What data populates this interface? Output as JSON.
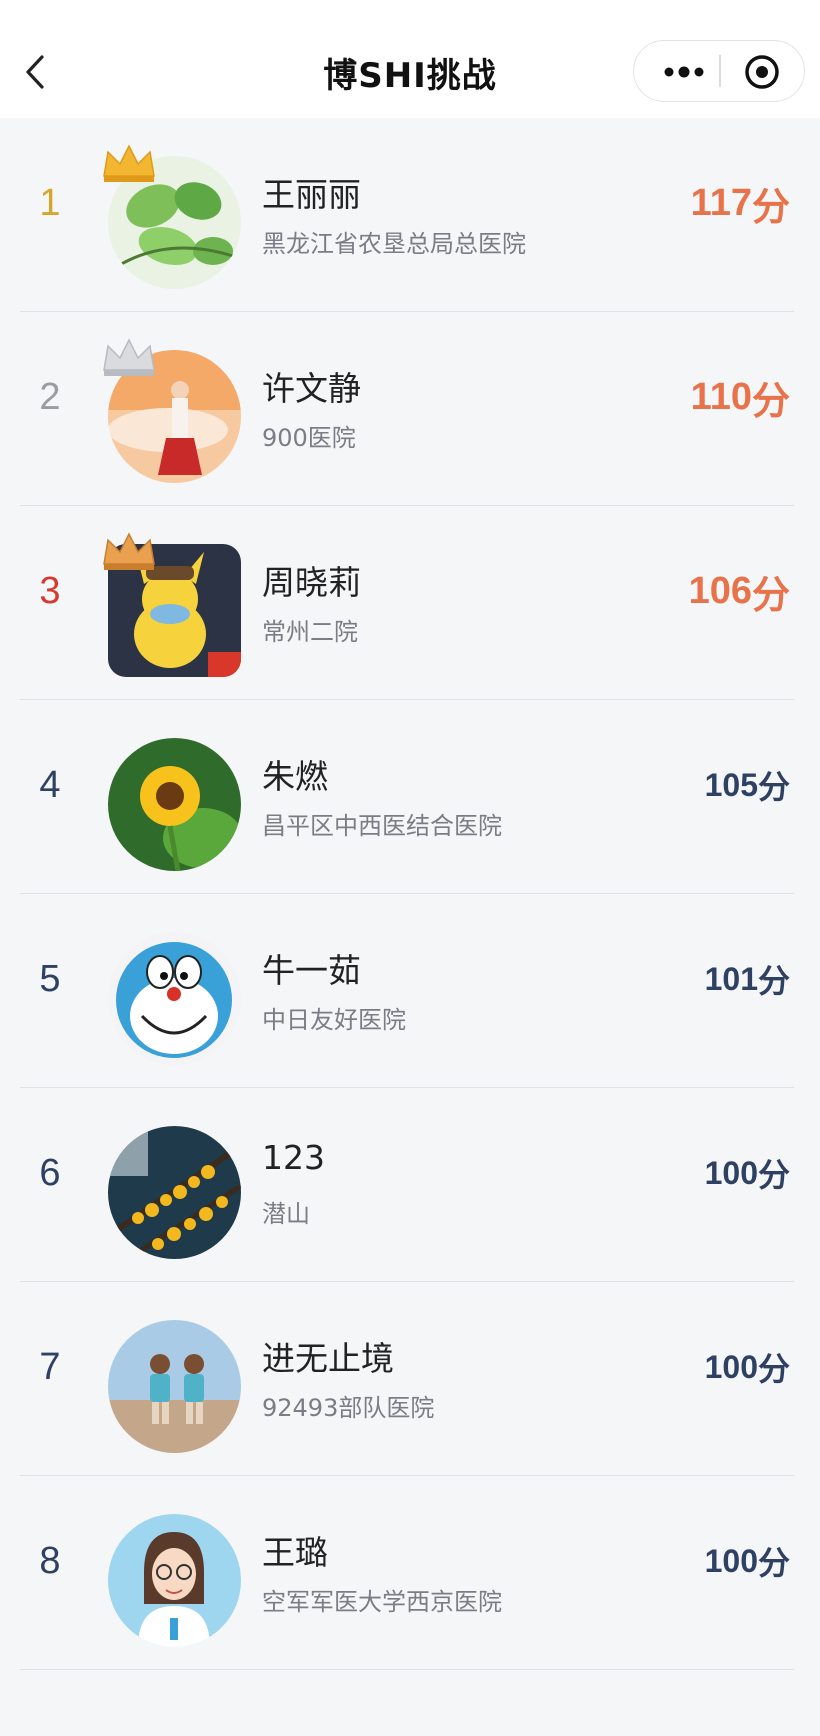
{
  "header": {
    "title": "博SHI挑战"
  },
  "leaderboard": [
    {
      "rank": "1",
      "name": "王丽丽",
      "org": "黑龙江省农垦总局总医院",
      "score": "117",
      "unit": "分"
    },
    {
      "rank": "2",
      "name": "许文静",
      "org": "900医院",
      "score": "110",
      "unit": "分"
    },
    {
      "rank": "3",
      "name": "周晓莉",
      "org": "常州二院",
      "score": "106",
      "unit": "分"
    },
    {
      "rank": "4",
      "name": "朱燃",
      "org": "昌平区中西医结合医院",
      "score": "105",
      "unit": "分"
    },
    {
      "rank": "5",
      "name": "牛一茹",
      "org": "中日友好医院",
      "score": "101",
      "unit": "分"
    },
    {
      "rank": "6",
      "name": "123",
      "org": "潜山",
      "score": "100",
      "unit": "分"
    },
    {
      "rank": "7",
      "name": "进无止境",
      "org": "92493部队医院",
      "score": "100",
      "unit": "分"
    },
    {
      "rank": "8",
      "name": "王璐",
      "org": "空军军医大学西京医院",
      "score": "100",
      "unit": "分"
    }
  ],
  "colors": {
    "top_score": "#e8724a",
    "normal_score": "#2f4163",
    "gold": "#d4a72c",
    "silver": "#9a9ca1",
    "bronze": "#d63a2f"
  },
  "icons": {
    "back": "chevron-left-icon",
    "more": "more-dots-icon",
    "close": "target-circle-icon",
    "crown": "crown-icon"
  }
}
